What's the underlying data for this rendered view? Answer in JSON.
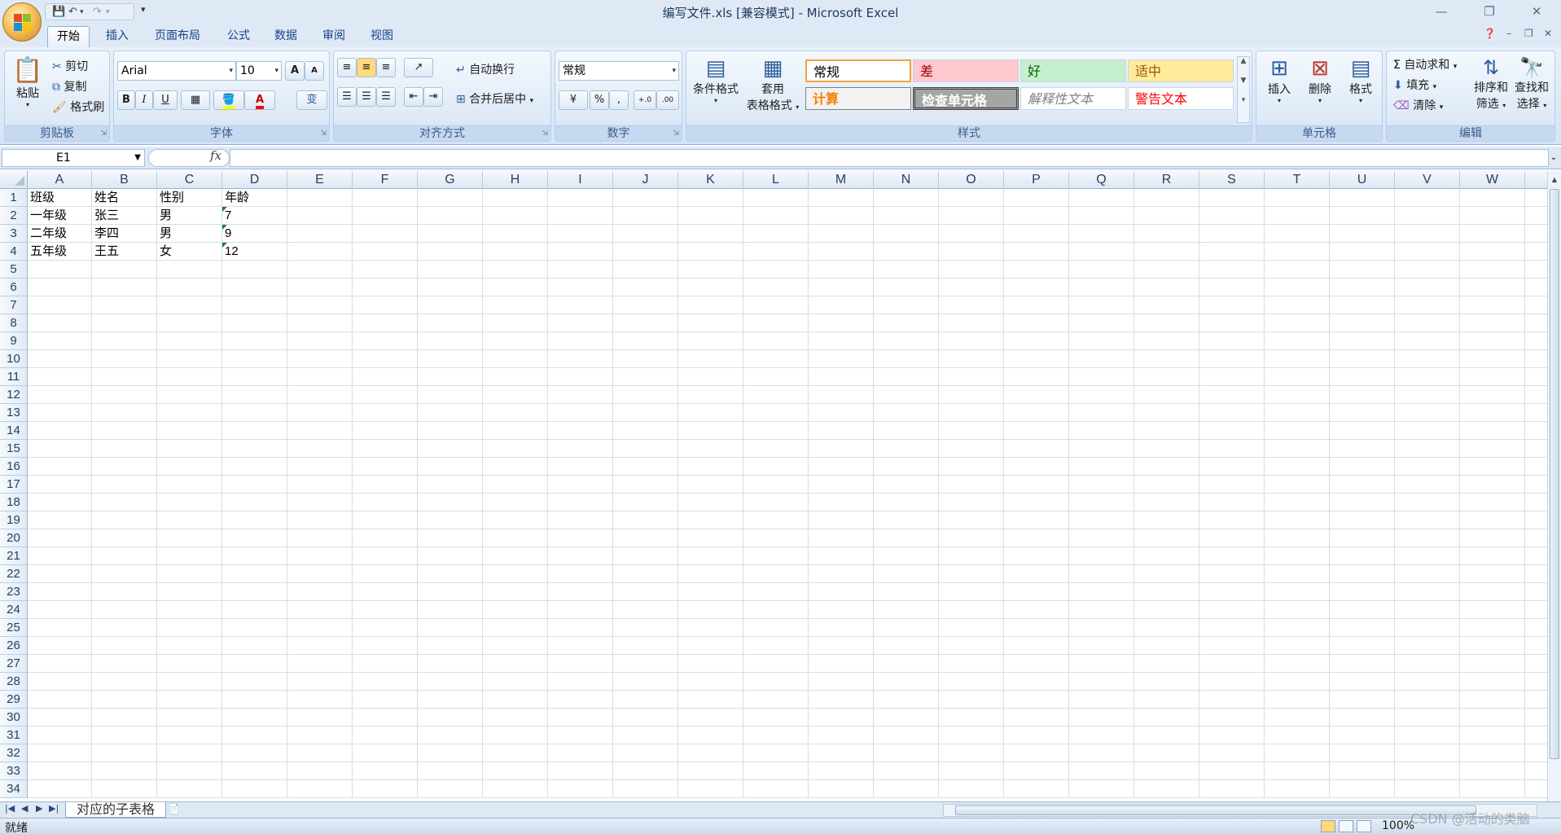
{
  "window": {
    "title": "编写文件.xls  [兼容模式] - Microsoft Excel",
    "controls": {
      "minimize": "—",
      "restore": "❐",
      "close": "✕"
    }
  },
  "qat": {
    "save_icon": "save-icon",
    "undo_icon": "undo-icon",
    "redo_icon": "redo-icon",
    "customize": "▾"
  },
  "tabs": [
    {
      "label": "开始",
      "active": true
    },
    {
      "label": "插入"
    },
    {
      "label": "页面布局"
    },
    {
      "label": "公式"
    },
    {
      "label": "数据"
    },
    {
      "label": "审阅"
    },
    {
      "label": "视图"
    }
  ],
  "ribbon": {
    "clipboard": {
      "label": "剪贴板",
      "paste": "粘贴",
      "cut": "剪切",
      "copy": "复制",
      "format_painter": "格式刷"
    },
    "font": {
      "label": "字体",
      "name": "Arial",
      "size": "10",
      "grow": "A",
      "shrink": "A",
      "bold": "B",
      "italic": "I",
      "underline": "U",
      "phonetic": "变"
    },
    "alignment": {
      "label": "对齐方式",
      "wrap_text": "自动换行",
      "merge_center": "合并后居中"
    },
    "number": {
      "label": "数字",
      "format": "常规",
      "percent": "%",
      "comma": ",",
      "inc_decimal": "+.0",
      "dec_decimal": ".00"
    },
    "styles": {
      "label": "样式",
      "conditional_formatting": "条件格式",
      "format_as_table_1": "套用",
      "format_as_table_2": "表格格式",
      "cells": [
        {
          "text": "常规",
          "color": "#000000",
          "bg": "#ffffff"
        },
        {
          "text": "差",
          "color": "#9c0006",
          "bg": "#ffc7ce"
        },
        {
          "text": "好",
          "color": "#006100",
          "bg": "#c6efce"
        },
        {
          "text": "适中",
          "color": "#9c5700",
          "bg": "#ffeb9c"
        },
        {
          "text": "计算",
          "color": "#fa7d00",
          "bg": "#f2f2f2"
        },
        {
          "text": "检查单元格",
          "color": "#ffffff",
          "bg": "#a5a5a5"
        },
        {
          "text": "解释性文本",
          "color": "#7f7f7f",
          "bg": "#ffffff"
        },
        {
          "text": "警告文本",
          "color": "#ff0000",
          "bg": "#ffffff"
        }
      ]
    },
    "cells": {
      "label": "单元格",
      "insert": "插入",
      "delete": "删除",
      "format": "格式"
    },
    "editing": {
      "label": "编辑",
      "autosum": "自动求和",
      "fill": "填充",
      "clear": "清除",
      "sort_filter_1": "排序和",
      "sort_filter_2": "筛选",
      "find_select_1": "查找和",
      "find_select_2": "选择"
    }
  },
  "formula_bar": {
    "name_box": "E1",
    "fx": "fx",
    "formula": ""
  },
  "sheet": {
    "columns": [
      "A",
      "B",
      "C",
      "D",
      "E",
      "F",
      "G",
      "H",
      "I",
      "J",
      "K",
      "L",
      "M",
      "N",
      "O",
      "P",
      "Q",
      "R",
      "S",
      "T",
      "U",
      "V",
      "W"
    ],
    "row_count": 34,
    "rows": [
      [
        "班级",
        "姓名",
        "性别",
        "年龄"
      ],
      [
        "一年级",
        "张三",
        "男",
        "7"
      ],
      [
        "二年级",
        "李四",
        "男",
        "9"
      ],
      [
        "五年级",
        "王五",
        "女",
        "12"
      ]
    ],
    "text_number_cells": [
      "D2",
      "D3",
      "D4"
    ]
  },
  "sheet_tabs": {
    "active": "对应的子表格"
  },
  "status": {
    "text": "就绪",
    "zoom": "100%"
  },
  "watermark": "CSDN @活动的类脑"
}
